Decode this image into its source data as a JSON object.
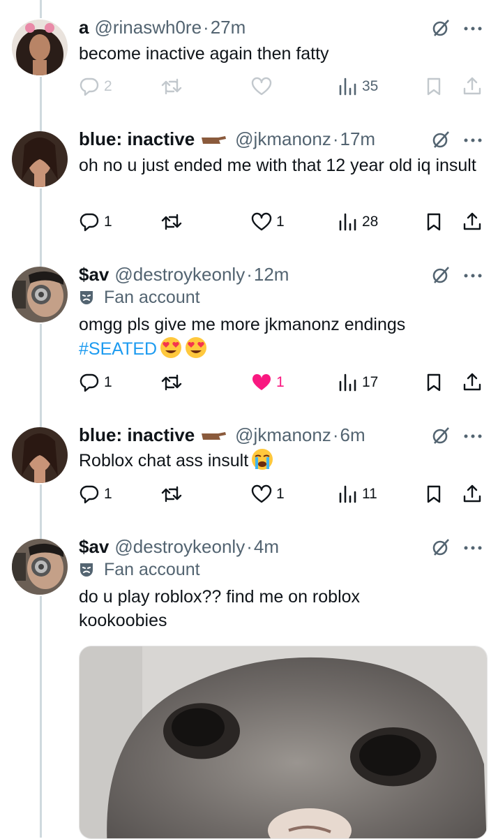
{
  "tweets": [
    {
      "name": "a",
      "handle": "@rinaswh0re",
      "time": "27m",
      "text": "become inactive again then fatty",
      "replies": "2",
      "retweets": "",
      "likes": "",
      "views": "35"
    },
    {
      "name": "blue: inactive",
      "handle": "@jkmanonz",
      "time": "17m",
      "text": "oh no u just ended me with that 12 year old iq insult",
      "replies": "1",
      "retweets": "",
      "likes": "1",
      "views": "28"
    },
    {
      "name": "$av",
      "handle": "@destroykeonly",
      "time": "12m",
      "badge": "Fan account",
      "text": "omgg pls give me more jkmanonz endings",
      "hashtag": "#SEATED",
      "replies": "1",
      "retweets": "",
      "likes": "1",
      "views": "17"
    },
    {
      "name": "blue: inactive",
      "handle": "@jkmanonz",
      "time": "6m",
      "text": "Roblox chat ass insult",
      "replies": "1",
      "retweets": "",
      "likes": "1",
      "views": "11"
    },
    {
      "name": "$av",
      "handle": "@destroykeonly",
      "time": "4m",
      "badge": "Fan account",
      "text": "do u play roblox?? find me on roblox kookoobies"
    }
  ],
  "separator": "·",
  "colors": {
    "secondary_text": "#536471",
    "link": "#1d9bf0",
    "like_active": "#f91880",
    "thread_line": "#cfd9de"
  },
  "icons": {
    "reply": "reply-icon",
    "retweet": "retweet-icon",
    "like": "heart-icon",
    "views": "views-icon",
    "bookmark": "bookmark-icon",
    "share": "share-icon",
    "grok": "grok-icon",
    "more": "more-icon",
    "fan_badge": "theater-mask-icon"
  }
}
